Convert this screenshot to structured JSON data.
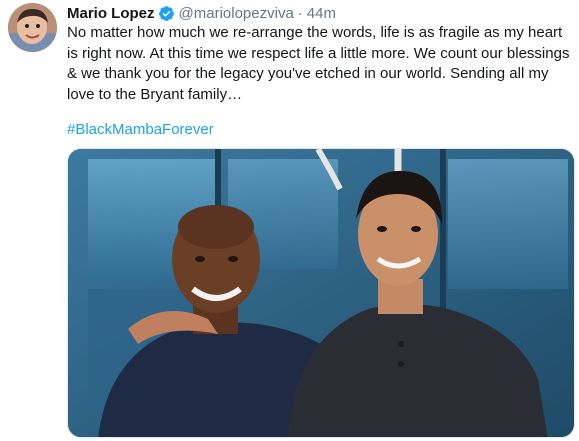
{
  "tweet": {
    "author_name": "Mario Lopez",
    "handle": "@mariolopezviva",
    "separator": "·",
    "timestamp": "44m",
    "text": "No matter how much we re-arrange the words, life is as fragile as my heart is right now. At this time we respect life a little more. We count our blessings & we thank you for the legacy you've etched in our world. Sending all my love to the Bryant family…",
    "hashtag": "#BlackMambaForever"
  },
  "icons": {
    "verified": "verified-badge-icon"
  },
  "colors": {
    "text": "#14171a",
    "secondary": "#657786",
    "link": "#1da1f2",
    "verified": "#1da1f2"
  }
}
